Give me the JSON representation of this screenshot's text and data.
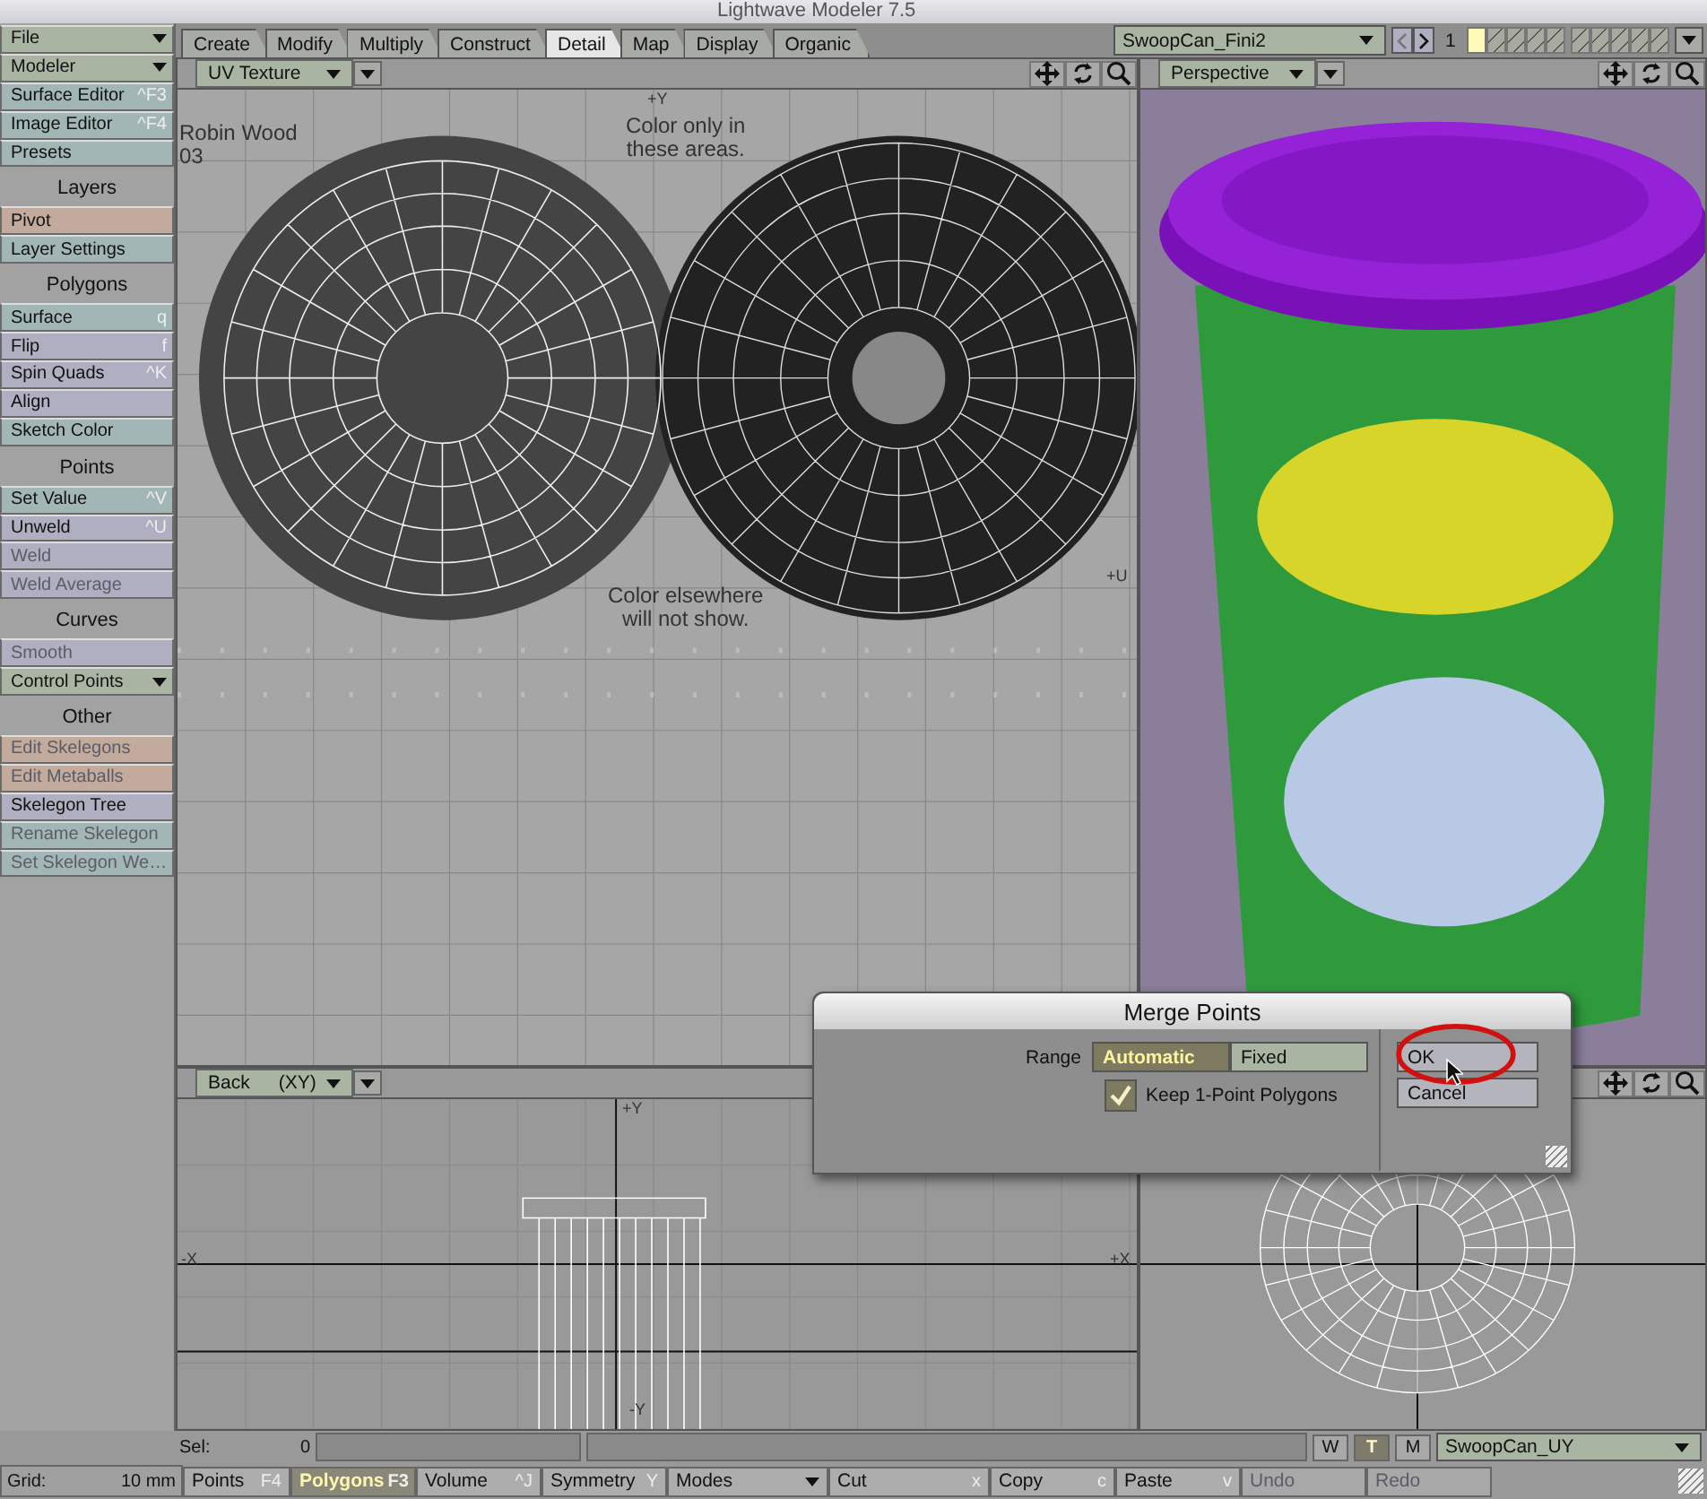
{
  "window": {
    "title": "Lightwave Modeler 7.5"
  },
  "sidebar": [
    {
      "kind": "button",
      "label": "File",
      "dropdown": true,
      "disabled": false,
      "color": "#a9b5a2"
    },
    {
      "kind": "button",
      "label": "Modeler",
      "dropdown": true,
      "disabled": false,
      "color": "#a9b5a2"
    },
    {
      "kind": "button",
      "label": "Surface Editor",
      "shortcut": "^F3",
      "dropdown": false,
      "disabled": false,
      "color": "#a3b6b6"
    },
    {
      "kind": "button",
      "label": "Image Editor",
      "shortcut": "^F4",
      "dropdown": false,
      "disabled": false,
      "color": "#a3b6b6"
    },
    {
      "kind": "button",
      "label": "Presets",
      "dropdown": false,
      "disabled": false,
      "color": "#a3b6b6"
    },
    {
      "kind": "header",
      "label": "Layers"
    },
    {
      "kind": "button",
      "label": "Pivot",
      "dropdown": false,
      "disabled": false,
      "color": "#c2ab9c"
    },
    {
      "kind": "button",
      "label": "Layer Settings",
      "dropdown": false,
      "disabled": false,
      "color": "#a3b6b6"
    },
    {
      "kind": "header",
      "label": "Polygons"
    },
    {
      "kind": "button",
      "label": "Surface",
      "shortcut": "q",
      "dropdown": false,
      "disabled": false,
      "color": "#a3b6b6"
    },
    {
      "kind": "button",
      "label": "Flip",
      "shortcut": "f",
      "dropdown": false,
      "disabled": false,
      "color": "#b0afc2"
    },
    {
      "kind": "button",
      "label": "Spin Quads",
      "shortcut": "^K",
      "dropdown": false,
      "disabled": false,
      "color": "#b0afc2"
    },
    {
      "kind": "button",
      "label": "Align",
      "dropdown": false,
      "disabled": false,
      "color": "#b0afc2"
    },
    {
      "kind": "button",
      "label": "Sketch Color",
      "dropdown": false,
      "disabled": false,
      "color": "#a3b6b6"
    },
    {
      "kind": "header",
      "label": "Points"
    },
    {
      "kind": "button",
      "label": "Set Value",
      "shortcut": "^V",
      "dropdown": false,
      "disabled": false,
      "color": "#a3b6b6"
    },
    {
      "kind": "button",
      "label": "Unweld",
      "shortcut": "^U",
      "dropdown": false,
      "disabled": false,
      "color": "#b0afc2"
    },
    {
      "kind": "button",
      "label": "Weld",
      "dropdown": false,
      "disabled": true,
      "color": "#b0afc2"
    },
    {
      "kind": "button",
      "label": "Weld Average",
      "dropdown": false,
      "disabled": true,
      "color": "#b0afc2"
    },
    {
      "kind": "header",
      "label": "Curves"
    },
    {
      "kind": "button",
      "label": "Smooth",
      "dropdown": false,
      "disabled": true,
      "color": "#b0afc2"
    },
    {
      "kind": "button",
      "label": "Control Points",
      "dropdown": true,
      "disabled": false,
      "color": "#a9b5a2"
    },
    {
      "kind": "header",
      "label": "Other"
    },
    {
      "kind": "button",
      "label": "Edit Skelegons",
      "dropdown": false,
      "disabled": true,
      "color": "#c2ab9c"
    },
    {
      "kind": "button",
      "label": "Edit Metaballs",
      "dropdown": false,
      "disabled": true,
      "color": "#c2ab9c"
    },
    {
      "kind": "button",
      "label": "Skelegon Tree",
      "dropdown": false,
      "disabled": false,
      "color": "#b0afc2"
    },
    {
      "kind": "button",
      "label": "Rename Skelegon",
      "dropdown": false,
      "disabled": true,
      "color": "#a3b6b6"
    },
    {
      "kind": "button",
      "label": "Set Skelegon We…",
      "dropdown": false,
      "disabled": true,
      "color": "#a3b6b6"
    }
  ],
  "tabs": [
    {
      "label": "Create",
      "selected": false
    },
    {
      "label": "Modify",
      "selected": false
    },
    {
      "label": "Multiply",
      "selected": false
    },
    {
      "label": "Construct",
      "selected": false
    },
    {
      "label": "Detail",
      "selected": true
    },
    {
      "label": "Map",
      "selected": false
    },
    {
      "label": "Display",
      "selected": false
    },
    {
      "label": "Organic",
      "selected": false
    }
  ],
  "object_selector": {
    "value": "SwoopCan_Fini2"
  },
  "layer_number": "1",
  "layers": [
    {
      "selected": true
    },
    {
      "selected": false
    },
    {
      "selected": false
    },
    {
      "selected": false
    },
    {
      "selected": false
    },
    {
      "selected": false
    },
    {
      "selected": false
    },
    {
      "selected": false
    },
    {
      "selected": false
    },
    {
      "selected": false
    }
  ],
  "viewports": [
    {
      "kind": "uv",
      "view": "UV Texture",
      "labels": [
        "Robin Wood\n03",
        "Color only in\nthese areas.",
        "Color elsewhere\nwill not show."
      ],
      "axis_labels": [
        "+Y",
        "+U"
      ]
    },
    {
      "kind": "perspective",
      "view": "Perspective"
    },
    {
      "kind": "back",
      "view": "Back",
      "axes": "(XY)",
      "axis_labels": [
        "+Y",
        "-X",
        "+X",
        "-Y"
      ]
    },
    {
      "kind": "top"
    }
  ],
  "dialog": {
    "title": "Merge Points",
    "range_label": "Range",
    "range_options": [
      {
        "label": "Automatic",
        "selected": true
      },
      {
        "label": "Fixed",
        "selected": false
      }
    ],
    "checkbox": {
      "label": "Keep 1-Point Polygons",
      "checked": true
    },
    "buttons": [
      "OK",
      "Cancel"
    ]
  },
  "status_bar": {
    "sel_label": "Sel:",
    "sel_value": "0",
    "view_modes": [
      {
        "label": "W",
        "selected": false
      },
      {
        "label": "T",
        "selected": true
      },
      {
        "label": "M",
        "selected": false
      }
    ],
    "uv_map": "SwoopCan_UY"
  },
  "bottom_bar": {
    "grid_label": "Grid:",
    "grid_value": "10 mm",
    "buttons": [
      {
        "label": "Points",
        "shortcut": "F4",
        "selected": false,
        "disabled": false,
        "dropdown": false
      },
      {
        "label": "Polygons",
        "shortcut": "F3",
        "selected": true,
        "disabled": false,
        "dropdown": false
      },
      {
        "label": "Volume",
        "shortcut": "^J",
        "selected": false,
        "disabled": false,
        "dropdown": false
      },
      {
        "label": "Symmetry",
        "shortcut": "Y",
        "selected": false,
        "disabled": false,
        "dropdown": false
      },
      {
        "label": "Modes",
        "selected": false,
        "disabled": false,
        "dropdown": true
      },
      {
        "label": "Cut",
        "shortcut": "x",
        "selected": false,
        "disabled": false,
        "dropdown": false
      },
      {
        "label": "Copy",
        "shortcut": "c",
        "selected": false,
        "disabled": false,
        "dropdown": false
      },
      {
        "label": "Paste",
        "shortcut": "v",
        "selected": false,
        "disabled": false,
        "dropdown": false
      },
      {
        "label": "Undo",
        "selected": false,
        "disabled": true,
        "dropdown": false
      },
      {
        "label": "Redo",
        "selected": false,
        "disabled": true,
        "dropdown": false
      }
    ]
  }
}
